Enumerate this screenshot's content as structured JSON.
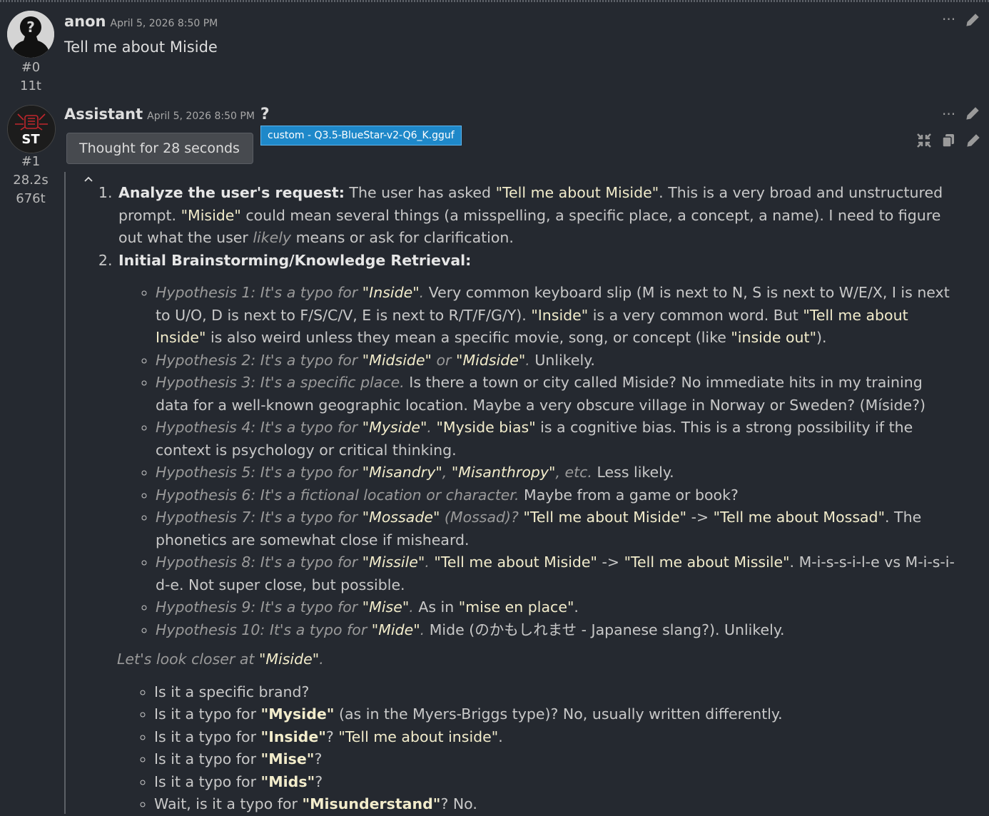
{
  "messages": [
    {
      "index": "#0",
      "tokens": "11t",
      "name": "anon",
      "timestamp": "April 5, 2026 8:50 PM",
      "text": "Tell me about Miside"
    },
    {
      "index": "#1",
      "time": "28.2s",
      "tokens": "676t",
      "name": "Assistant",
      "timestamp": "April 5, 2026 8:50 PM",
      "help": "?",
      "avatar_text": "ST",
      "thought_label": "Thought for 28 seconds",
      "model_tag": "custom - Q3.5-BlueStar-v2-Q6_K.gguf"
    }
  ],
  "icons": {
    "more": "more-horizontal-icon",
    "edit": "pencil-icon",
    "collapse": "collapse-icon",
    "copy": "copy-icon",
    "chevron": "chevron-up-icon"
  },
  "reasoning": {
    "step1": {
      "label": "Analyze the user's request:",
      "t1": " The user has asked ",
      "q1": "\"Tell me about Miside\"",
      "t2": ". This is a very broad and unstructured prompt. ",
      "q2": "\"Miside\"",
      "t3": " could mean several things (a misspelling, a specific place, a concept, a name). I need to figure out what the user ",
      "em": "likely",
      "t4": " means or ask for clarification."
    },
    "step2": {
      "label": "Initial Brainstorming/Knowledge Retrieval:"
    },
    "h1": {
      "lead": "Hypothesis 1: It's a typo for ",
      "q": "\"Inside\"",
      "dot": ".",
      "t1": " Very common keyboard slip (M is next to N, S is next to W/E/X, I is next to U/O, D is next to F/S/C/V, E is next to R/T/F/G/Y). ",
      "q2": "\"Inside\"",
      "t2": " is a very common word. But ",
      "q3": "\"Tell me about Inside\"",
      "t3": " is also weird unless they mean a specific movie, song, or concept (like ",
      "q4": "\"inside out\"",
      "t4": ")."
    },
    "h2": {
      "lead": "Hypothesis 2: It's a typo for ",
      "q": "\"Midside\"",
      "or": " or ",
      "q2": "\"Midside\"",
      "dot": ".",
      "t1": " Unlikely."
    },
    "h3": {
      "lead": "Hypothesis 3: It's a specific place.",
      "t1": " Is there a town or city called Miside? No immediate hits in my training data for a well-known geographic location. Maybe a very obscure village in Norway or Sweden? (Míside?)"
    },
    "h4": {
      "lead": "Hypothesis 4: It's a typo for ",
      "q": "\"Myside\"",
      "dot": ".",
      "t0": " ",
      "q2": "\"Myside bias\"",
      "t1": " is a cognitive bias. This is a strong possibility if the context is psychology or critical thinking."
    },
    "h5": {
      "lead": "Hypothesis 5: It's a typo for ",
      "q": "\"Misandry\"",
      "c": ", ",
      "q2": "\"Misanthropy\"",
      "etc": ", etc.",
      "t1": " Less likely."
    },
    "h6": {
      "lead": "Hypothesis 6: It's a fictional location or character.",
      "t1": " Maybe from a game or book?"
    },
    "h7": {
      "lead": "Hypothesis 7: It's a typo for ",
      "q": "\"Mossade\"",
      "paren": " (Mossad)?",
      "t0": " ",
      "q2": "\"Tell me about Miside\"",
      "arrow": " -> ",
      "q3": "\"Tell me about Mossad\"",
      "t1": ". The phonetics are somewhat close if misheard."
    },
    "h8": {
      "lead": "Hypothesis 8: It's a typo for ",
      "q": "\"Missile\"",
      "dot": ".",
      "t0": " ",
      "q2": "\"Tell me about Miside\"",
      "arrow": " -> ",
      "q3": "\"Tell me about Missile\"",
      "t1": ". M-i-s-s-i-l-e vs M-i-s-i-d-e. Not super close, but possible."
    },
    "h9": {
      "lead": "Hypothesis 9: It's a typo for ",
      "q": "\"Mise\"",
      "dot": ".",
      "t0": " As in ",
      "q2": "\"mise en place\"",
      "t1": "."
    },
    "h10": {
      "lead": "Hypothesis 10: It's a typo for ",
      "q": "\"Mide\"",
      "dot": ".",
      "t1": " Mide (のかもしれませ - Japanese slang?). Unlikely."
    },
    "closer": {
      "lead": "Let's look closer at ",
      "q": "\"Miside\"",
      "dot": "."
    },
    "c1": {
      "t": "Is it a specific brand?"
    },
    "c2": {
      "a": "Is it a typo for ",
      "q": "\"Myside\"",
      "b": " (as in the Myers-Briggs type)? No, usually written differently."
    },
    "c3": {
      "a": "Is it a typo for ",
      "q": "\"Inside\"",
      "b": "? ",
      "q2": "\"Tell me about inside\"",
      "c": "."
    },
    "c4": {
      "a": "Is it a typo for ",
      "q": "\"Mise\"",
      "b": "?"
    },
    "c5": {
      "a": "Is it a typo for ",
      "q": "\"Mids\"",
      "b": "?"
    },
    "c6": {
      "a": "Wait, is it a typo for ",
      "q": "\"Misunderstand\"",
      "b": "? No."
    }
  }
}
